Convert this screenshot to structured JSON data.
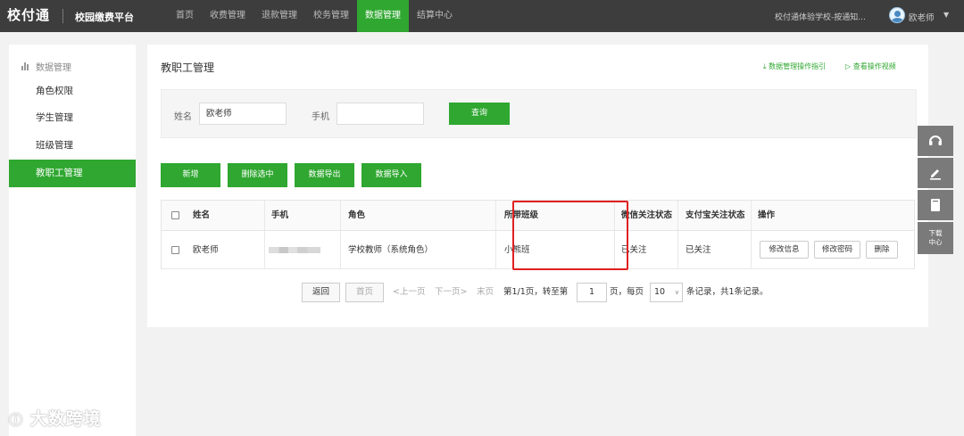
{
  "topbar": {
    "logo": "校付通",
    "platform": "校园缴费平台",
    "nav": [
      "首页",
      "收费管理",
      "退款管理",
      "校务管理",
      "数据管理",
      "结算中心"
    ],
    "active_nav": "数据管理",
    "school": "校付通体验学校-按通知...",
    "user": "欧老师",
    "accent_color": "#2fa730"
  },
  "sidebar": {
    "header": "数据管理",
    "items": [
      "角色权限",
      "学生管理",
      "班级管理",
      "教职工管理"
    ]
  },
  "main": {
    "title": "教职工管理",
    "links": {
      "guide": "数据管理操作指引",
      "video": "查看操作视频"
    },
    "search": {
      "name_label": "姓名",
      "name_value": "欧老师",
      "phone_label": "手机",
      "phone_value": "",
      "query_button": "查询"
    },
    "actions": [
      "新增",
      "删除选中",
      "数据导出",
      "数据导入"
    ],
    "table": {
      "columns": [
        "姓名",
        "手机",
        "角色",
        "所带班级",
        "微信关注状态",
        "支付宝关注状态",
        "操作"
      ],
      "rows": [
        {
          "name": "欧老师",
          "phone": "",
          "role": "学校教师（系统角色）",
          "class": "小熊班",
          "wechat": "已关注",
          "alipay": "已关注",
          "ops": [
            "修改信息",
            "修改密码",
            "删除"
          ]
        }
      ]
    },
    "pagination": {
      "back": "返回",
      "first": "首页",
      "prev": "<上一页",
      "next": "下一页>",
      "last": "末页",
      "info": "第1/1页，转至第",
      "page_input": "1",
      "page_suffix": "页，每页",
      "per_page": "10",
      "records": "条记录，共1条记录。"
    }
  },
  "right_tools": {
    "download_label_1": "下载",
    "download_label_2": "中心"
  },
  "watermark": "大数跨境"
}
